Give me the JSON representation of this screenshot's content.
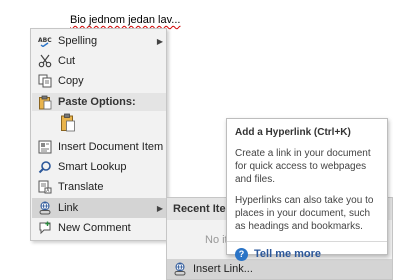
{
  "document": {
    "text": "Bio jednom jedan lav..."
  },
  "context_menu": {
    "items": [
      {
        "name": "spelling",
        "label": "Spelling",
        "has_submenu": true,
        "icon": "spell-check-icon"
      },
      {
        "name": "cut",
        "label": "Cut",
        "icon": "scissors-icon"
      },
      {
        "name": "copy",
        "label": "Copy",
        "icon": "copy-icon"
      },
      {
        "name": "paste-options",
        "label": "Paste Options:",
        "icon": "clipboard-icon"
      },
      {
        "name": "insert-document-item",
        "label": "Insert Document Item",
        "icon": "document-item-icon"
      },
      {
        "name": "smart-lookup",
        "label": "Smart Lookup",
        "icon": "search-icon"
      },
      {
        "name": "translate",
        "label": "Translate",
        "icon": "translate-icon"
      },
      {
        "name": "link",
        "label": "Link",
        "has_submenu": true,
        "icon": "link-icon",
        "highlighted": true
      },
      {
        "name": "new-comment",
        "label": "New Comment",
        "icon": "comment-icon"
      }
    ]
  },
  "link_submenu": {
    "header": "Recent Items",
    "empty_text": "No it",
    "insert_link_label": "Insert Link..."
  },
  "tooltip": {
    "title": "Add a Hyperlink (Ctrl+K)",
    "paragraph1": "Create a link in your document for quick access to webpages and files.",
    "paragraph2": "Hyperlinks can also take you to places in your document, such as headings and bookmarks.",
    "tell_me_more": "Tell me more"
  },
  "colors": {
    "menu_bg": "#f2f2f2",
    "highlight": "#d4d4d4",
    "link_blue": "#2b579a",
    "spell_red": "#d00000"
  }
}
